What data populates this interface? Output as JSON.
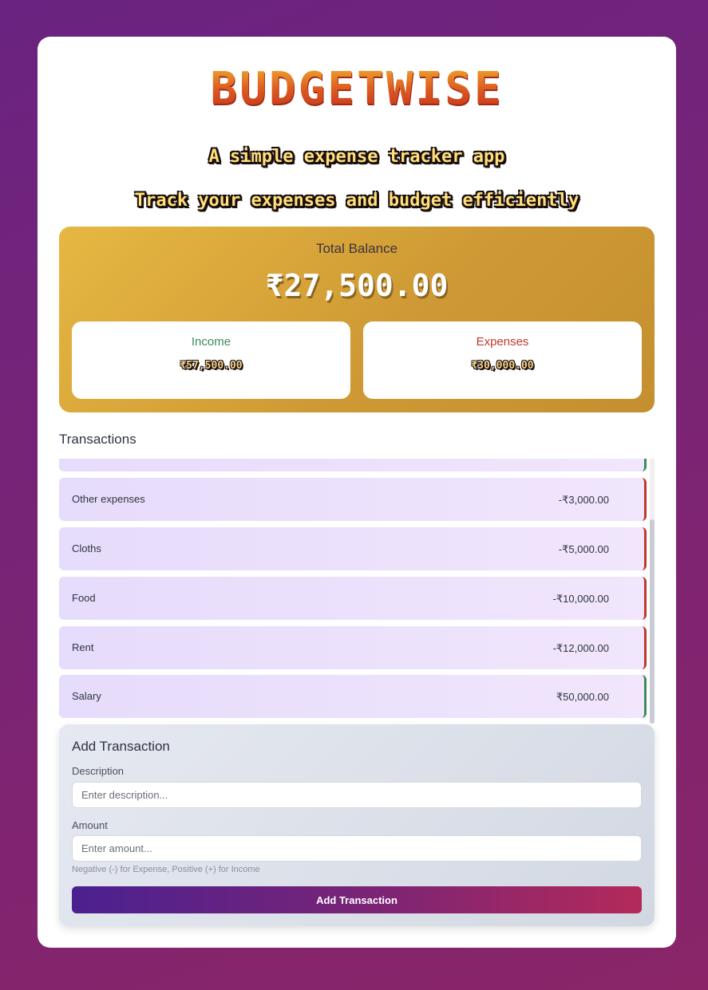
{
  "app": {
    "logo": "BUDGETWISE",
    "tagline_1": "A simple expense tracker app",
    "tagline_2": "Track your expenses and budget efficiently"
  },
  "balance": {
    "label": "Total Balance",
    "amount": "₹27,500.00",
    "income_label": "Income",
    "income_amount": "₹57,500.00",
    "expense_label": "Expenses",
    "expense_amount": "₹30,000.00"
  },
  "transactions": {
    "title": "Transactions",
    "items": [
      {
        "description": "Other expenses",
        "amount": "-₹3,000.00",
        "type": "expense"
      },
      {
        "description": "Cloths",
        "amount": "-₹5,000.00",
        "type": "expense"
      },
      {
        "description": "Food",
        "amount": "-₹10,000.00",
        "type": "expense"
      },
      {
        "description": "Rent",
        "amount": "-₹12,000.00",
        "type": "expense"
      },
      {
        "description": "Salary",
        "amount": "₹50,000.00",
        "type": "income"
      }
    ]
  },
  "add_transaction": {
    "title": "Add Transaction",
    "description_label": "Description",
    "description_placeholder": "Enter description...",
    "amount_label": "Amount",
    "amount_placeholder": "Enter amount...",
    "hint": "Negative (-) for Expense, Positive (+) for Income",
    "button_label": "Add Transaction"
  },
  "colors": {
    "income": "#3d8a5e",
    "expense": "#c0392b",
    "accent_start": "#4a2190",
    "accent_end": "#b32a5a"
  }
}
